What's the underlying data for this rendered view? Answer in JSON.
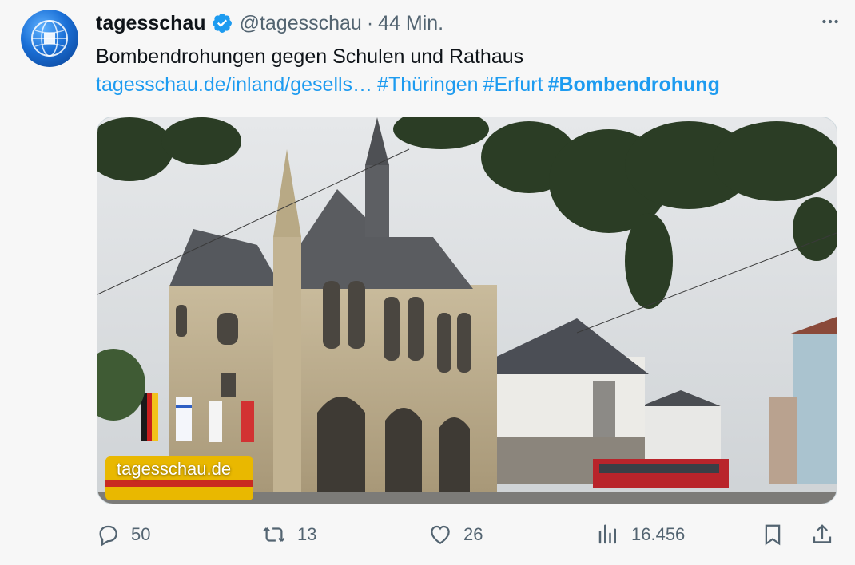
{
  "tweet": {
    "display_name": "tagesschau",
    "handle": "@tagesschau",
    "separator": "·",
    "time": "44 Min.",
    "text": "Bombendrohungen gegen Schulen und Rathaus",
    "link": "tagesschau.de/inland/gesells…",
    "hashtags": [
      "#Thüringen",
      "#Erfurt",
      "#Bombendrohung"
    ],
    "media_watermark": "tagesschau.de"
  },
  "metrics": {
    "replies": "50",
    "reposts": "13",
    "likes": "26",
    "views": "16.456"
  },
  "icons": {
    "avatar": "tagesschau-logo",
    "verified": "verified-badge-icon",
    "more": "more-icon",
    "reply": "reply-icon",
    "repost": "repost-icon",
    "like": "heart-icon",
    "views": "views-icon",
    "bookmark": "bookmark-icon",
    "share": "share-icon"
  },
  "colors": {
    "link": "#1d9bf0",
    "secondary_text": "#536471",
    "primary_text": "#0f1419",
    "background": "#f7f7f7"
  }
}
